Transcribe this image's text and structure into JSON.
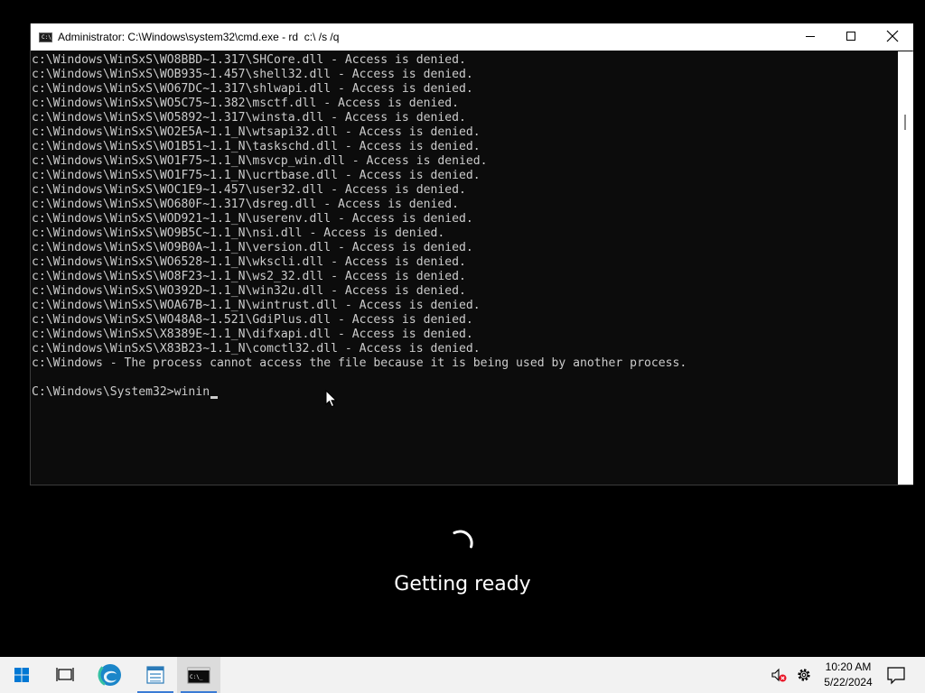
{
  "window": {
    "title": "Administrator: C:\\Windows\\system32\\cmd.exe - rd  c:\\ /s /q"
  },
  "console": {
    "lines": [
      "c:\\Windows\\WinSxS\\WO8BBD~1.317\\SHCore.dll - Access is denied.",
      "c:\\Windows\\WinSxS\\WOB935~1.457\\shell32.dll - Access is denied.",
      "c:\\Windows\\WinSxS\\WO67DC~1.317\\shlwapi.dll - Access is denied.",
      "c:\\Windows\\WinSxS\\WO5C75~1.382\\msctf.dll - Access is denied.",
      "c:\\Windows\\WinSxS\\WO5892~1.317\\winsta.dll - Access is denied.",
      "c:\\Windows\\WinSxS\\WO2E5A~1.1_N\\wtsapi32.dll - Access is denied.",
      "c:\\Windows\\WinSxS\\WO1B51~1.1_N\\taskschd.dll - Access is denied.",
      "c:\\Windows\\WinSxS\\WO1F75~1.1_N\\msvcp_win.dll - Access is denied.",
      "c:\\Windows\\WinSxS\\WO1F75~1.1_N\\ucrtbase.dll - Access is denied.",
      "c:\\Windows\\WinSxS\\WOC1E9~1.457\\user32.dll - Access is denied.",
      "c:\\Windows\\WinSxS\\WO680F~1.317\\dsreg.dll - Access is denied.",
      "c:\\Windows\\WinSxS\\WOD921~1.1_N\\userenv.dll - Access is denied.",
      "c:\\Windows\\WinSxS\\WO9B5C~1.1_N\\nsi.dll - Access is denied.",
      "c:\\Windows\\WinSxS\\WO9B0A~1.1_N\\version.dll - Access is denied.",
      "c:\\Windows\\WinSxS\\WO6528~1.1_N\\wkscli.dll - Access is denied.",
      "c:\\Windows\\WinSxS\\WO8F23~1.1_N\\ws2_32.dll - Access is denied.",
      "c:\\Windows\\WinSxS\\WO392D~1.1_N\\win32u.dll - Access is denied.",
      "c:\\Windows\\WinSxS\\WOA67B~1.1_N\\wintrust.dll - Access is denied.",
      "c:\\Windows\\WinSxS\\WO48A8~1.521\\GdiPlus.dll - Access is denied.",
      "c:\\Windows\\WinSxS\\X8389E~1.1_N\\difxapi.dll - Access is denied.",
      "c:\\Windows\\WinSxS\\X83B23~1.1_N\\comctl32.dll - Access is denied.",
      "c:\\Windows - The process cannot access the file because it is being used by another process.",
      "",
      "C:\\Windows\\System32>winin"
    ]
  },
  "overlay": {
    "status": "Getting ready"
  },
  "taskbar": {
    "items": [
      "start-icon",
      "task-view-icon",
      "edge-icon",
      "file-explorer-icon",
      "cmd-icon"
    ]
  },
  "tray": {
    "icons": [
      "volume-muted-icon",
      "gear-icon",
      "notification-icon"
    ],
    "time": "10:20 AM",
    "date": "5/22/2024"
  },
  "colors": {
    "console_bg": "#0c0c0c",
    "console_fg": "#cccccc",
    "taskbar_bg": "#f2f2f2",
    "active_underline": "#3a7bd5"
  }
}
